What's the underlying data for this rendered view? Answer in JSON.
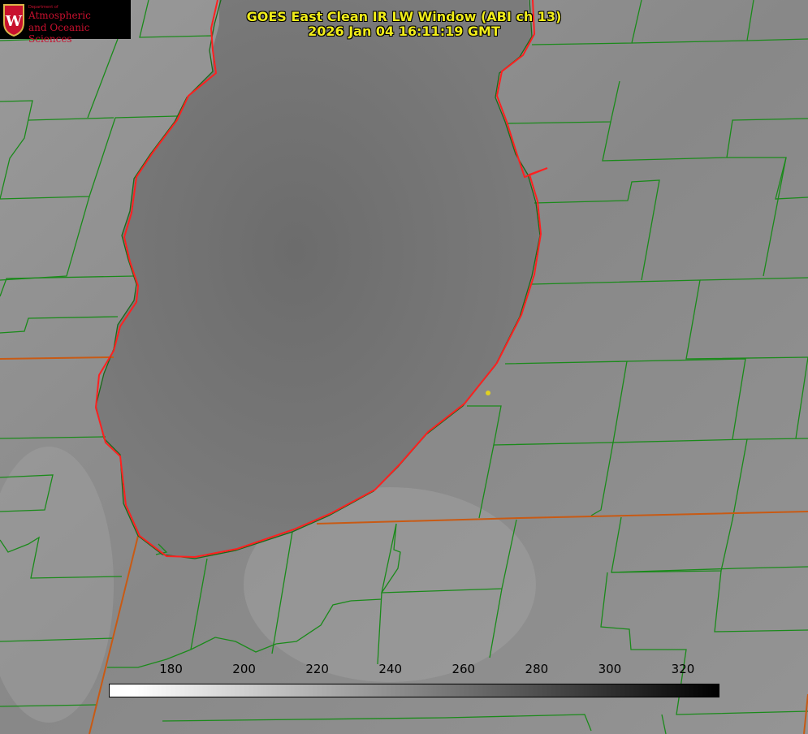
{
  "title": {
    "line1": "GOES East Clean IR LW Window (ABI ch 13)",
    "line2": "2026 Jan 04 16:11:19 GMT"
  },
  "logo": {
    "dept": "Department of",
    "line1": "Atmospheric",
    "line2": "and Oceanic Sciences",
    "crest_letter": "W",
    "color": "#c8102e"
  },
  "colorbar": {
    "ticks": [
      "180",
      "200",
      "220",
      "240",
      "260",
      "280",
      "300",
      "320"
    ],
    "range": [
      163,
      330
    ]
  },
  "colors": {
    "title": "#f0ec1a",
    "county_lines": "#1a8a1a",
    "state_lines": "#c85a14",
    "coastline": "#ff2020",
    "marker": "#e0d020"
  }
}
